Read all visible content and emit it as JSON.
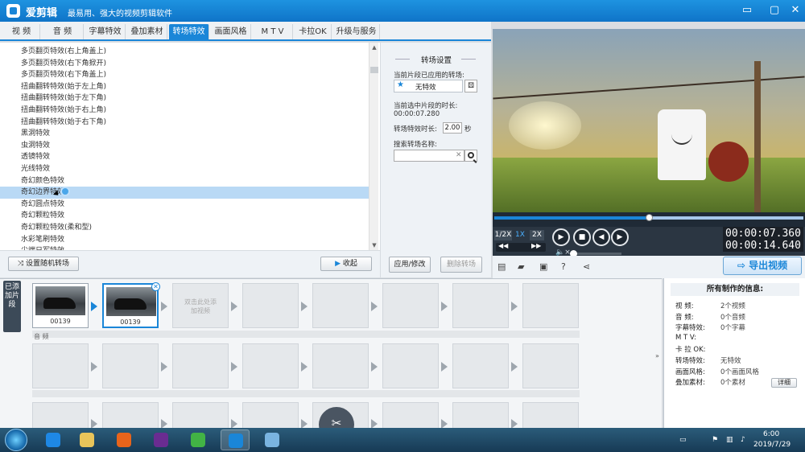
{
  "window": {
    "app_name": "爱剪辑",
    "slogan": "最易用、强大的视频剪辑软件",
    "controls": [
      "▭",
      "▢",
      "✕"
    ]
  },
  "tabs": [
    {
      "label": "视  频",
      "active": false
    },
    {
      "label": "音  频",
      "active": false
    },
    {
      "label": "字幕特效",
      "active": false
    },
    {
      "label": "叠加素材",
      "active": false
    },
    {
      "label": "转场特效",
      "active": true
    },
    {
      "label": "画面风格",
      "active": false
    },
    {
      "label": "M T V",
      "active": false
    },
    {
      "label": "卡拉OK",
      "active": false
    },
    {
      "label": "升级与服务",
      "active": false
    }
  ],
  "transitions": {
    "items": [
      "多页翻页特效(右上角盖上)",
      "多页翻页特效(右下角掀开)",
      "多页翻页特效(右下角盖上)",
      "扭曲翻转特效(始于左上角)",
      "扭曲翻转特效(始于左下角)",
      "扭曲翻转特效(始于右上角)",
      "扭曲翻转特效(始于右下角)",
      "黑洞特效",
      "虫洞特效",
      "透镜特效",
      "光线特效",
      "奇幻颜色特效",
      "奇幻边界特效",
      "奇幻圆点特效",
      "奇幻颗粒特效",
      "奇幻颗粒特效(柔和型)",
      "水彩笔刷特效",
      "尖端日军特效"
    ],
    "selected_index": 12
  },
  "left_buttons": {
    "random": "设置随机转场",
    "collapse": "收起"
  },
  "settings": {
    "title": "转场设置",
    "applied_label": "当前片段已应用的转场:",
    "applied_value": "无特效",
    "duration_label": "当前选中片段的时长:",
    "duration_value": "00:00:07.280",
    "effect_duration_label": "转场特效时长:",
    "effect_duration_value": "2.00",
    "effect_duration_unit": "秒",
    "search_label": "搜索转场名称:",
    "search_value": "",
    "apply_btn": "应用/修改",
    "delete_btn": "删除转场"
  },
  "player": {
    "progress": 0.5,
    "speeds": [
      "1/2X",
      "1X",
      "2X"
    ],
    "active_speed": 1,
    "current_time": "00:00:07.360",
    "total_time": "00:00:14.640",
    "volume": 0.0,
    "export_label": "导出视频"
  },
  "timeline": {
    "track_label": "已添加片段",
    "clips": [
      {
        "caption": "00139"
      },
      {
        "caption": "00139"
      }
    ],
    "selected_clip": 1,
    "add_hint": "双击此处添加视频",
    "audio_label": "音 频"
  },
  "info": {
    "title": "所有制作的信息:",
    "rows": [
      {
        "k": "视    频:",
        "v": "2个视频"
      },
      {
        "k": "音    频:",
        "v": "0个音频"
      },
      {
        "k": "字幕特效:",
        "v": "0个字幕"
      },
      {
        "k": "M  T  V:",
        "v": ""
      },
      {
        "k": "卡 拉 OK:",
        "v": ""
      },
      {
        "k": "转场特效:",
        "v": "无特效"
      },
      {
        "k": "画面风格:",
        "v": "0个画面风格"
      },
      {
        "k": "叠加素材:",
        "v": "0个素材"
      }
    ],
    "detail_btn": "详细"
  },
  "taskbar": {
    "time": "6:00",
    "date": "2019/7/29",
    "apps": [
      {
        "name": "media-player",
        "color": "#1e88e5"
      },
      {
        "name": "file-explorer",
        "color": "#e8c45a"
      },
      {
        "name": "firefox",
        "color": "#e8641b"
      },
      {
        "name": "media-app",
        "color": "#6a2c91"
      },
      {
        "name": "refresh-app",
        "color": "#42b345"
      },
      {
        "name": "aijianji",
        "color": "#1a86d8"
      },
      {
        "name": "viewer-app",
        "color": "#7ab4e0"
      }
    ]
  }
}
